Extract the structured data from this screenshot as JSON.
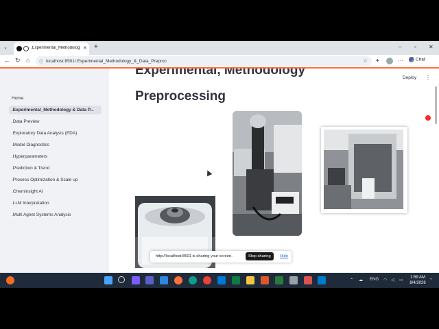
{
  "browser": {
    "tab_title": ".Experimental_Methodology",
    "url": "localhost:8501/.Experimental_Methodology_&_Data_Preproc",
    "chat_label": "Chat"
  },
  "app": {
    "deploy_label": "Deploy",
    "heading_partial": "Experimental, Methodology",
    "heading": "Preprocessing"
  },
  "sidebar": {
    "items": [
      {
        "label": "Home"
      },
      {
        "label": ".Experimental_Methodology & Data P..."
      },
      {
        "label": ".Data Preview"
      },
      {
        "label": ".Exploratory Data Analysis (EDA)"
      },
      {
        "label": ".Model Diagnostics"
      },
      {
        "label": ".Hyperparameters"
      },
      {
        "label": ".Prediction & Trend"
      },
      {
        "label": ".Process Optimization & Scale up"
      },
      {
        "label": ".Cheminsight AI"
      },
      {
        "label": ".LLM Interpretation"
      },
      {
        "label": ".Multi Agnet Systems Analysis"
      }
    ]
  },
  "share_bar": {
    "message": "http://localhost:8501 is sharing your screen.",
    "stop_label": "Stop sharing",
    "hide_label": "Hide"
  },
  "taskbar": {
    "lang": "ENG",
    "time": "1:59 AM",
    "date": "8/4/2026"
  },
  "colors": {
    "accent": "#ff6f3c",
    "sidebar_bg": "#f0f2f6",
    "text": "#31333f"
  }
}
